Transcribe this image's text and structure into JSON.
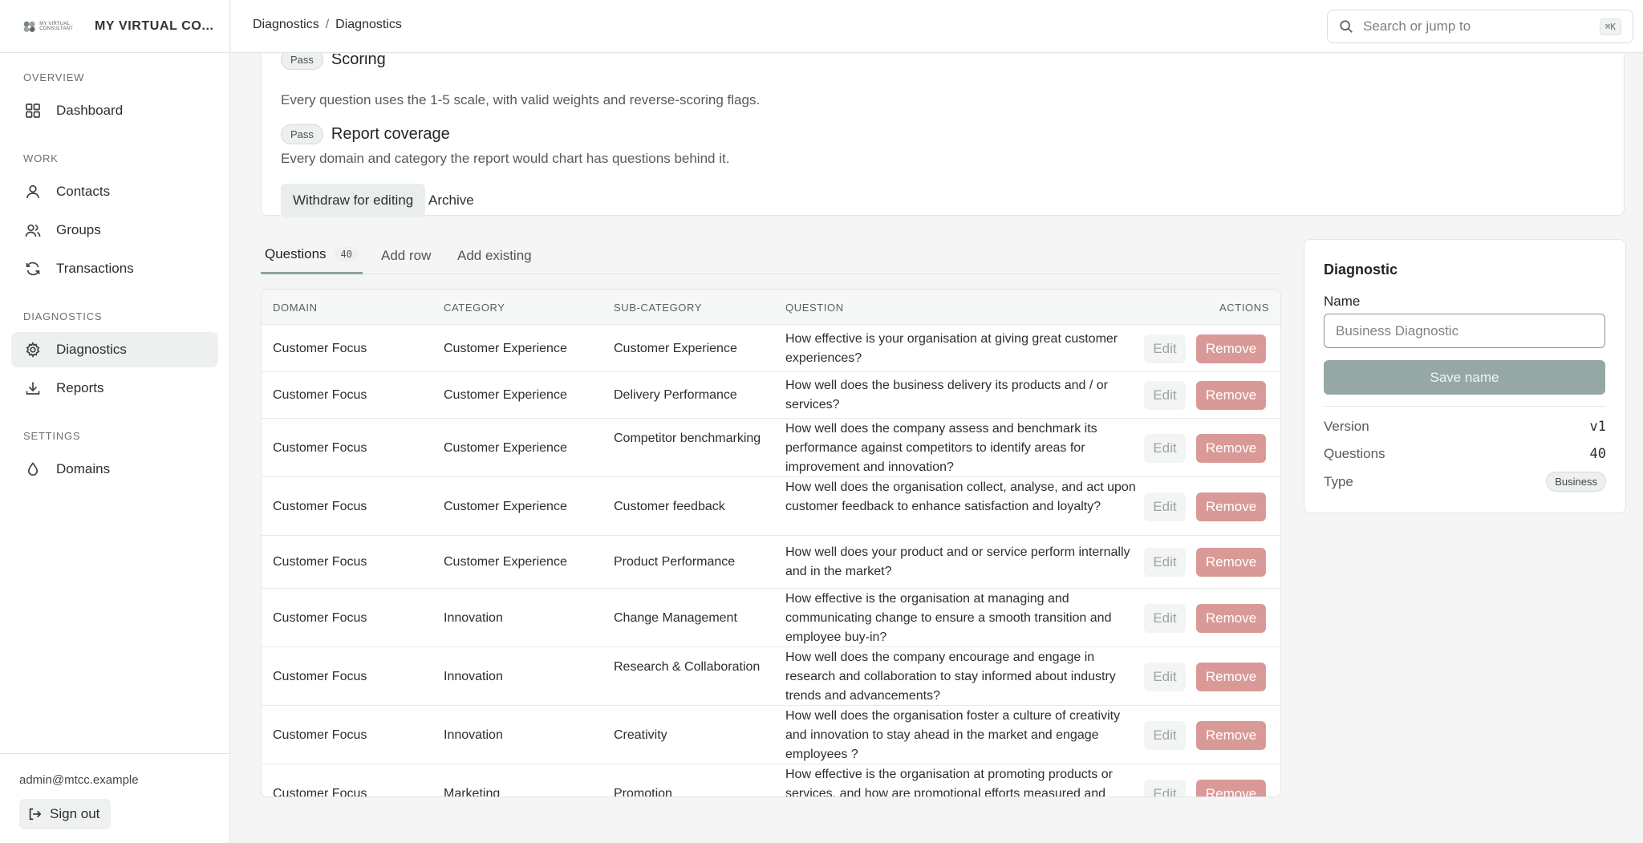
{
  "brand": {
    "logo_text": "MY VIRTUAL CONSULTANT",
    "name": "MY VIRTUAL CO..."
  },
  "sidebar": {
    "sections": [
      {
        "label": "OVERVIEW"
      },
      {
        "label": "WORK"
      },
      {
        "label": "DIAGNOSTICS"
      },
      {
        "label": "SETTINGS"
      }
    ],
    "items": [
      {
        "label": "Dashboard",
        "icon": "grid-icon"
      },
      {
        "label": "Contacts",
        "icon": "user-icon"
      },
      {
        "label": "Groups",
        "icon": "users-icon"
      },
      {
        "label": "Transactions",
        "icon": "refresh-icon"
      },
      {
        "label": "Diagnostics",
        "icon": "gear-icon",
        "active": true
      },
      {
        "label": "Reports",
        "icon": "download-icon"
      },
      {
        "label": "Domains",
        "icon": "drop-icon"
      }
    ],
    "user_email": "admin@mtcc.example",
    "signout_label": "Sign out"
  },
  "topbar": {
    "breadcrumb": [
      "Diagnostics",
      "/",
      "Diagnostics"
    ],
    "search_placeholder": "Search or jump to",
    "search_shortcut": "⌘K"
  },
  "checks": [
    {
      "badge": "Pass",
      "title": "Scoring",
      "description": "Every question uses the 1-5 scale, with valid weights and reverse-scoring flags."
    },
    {
      "badge": "Pass",
      "title": "Report coverage",
      "description": "Every domain and category the report would chart has questions behind it."
    }
  ],
  "actions": {
    "withdraw_label": "Withdraw for editing",
    "archive_label": "Archive"
  },
  "tabs": [
    {
      "label": "Questions",
      "count": "40",
      "active": true
    },
    {
      "label": "Add row"
    },
    {
      "label": "Add existing"
    }
  ],
  "table": {
    "columns": [
      "DOMAIN",
      "CATEGORY",
      "SUB-CATEGORY",
      "QUESTION",
      "ACTIONS"
    ],
    "edit_label": "Edit",
    "remove_label": "Remove",
    "rows": [
      {
        "domain": "Customer Focus",
        "category": "Customer Experience",
        "subcategory": "Customer Experience",
        "question": "How effective is your organisation at giving great customer experiences?"
      },
      {
        "domain": "Customer Focus",
        "category": "Customer Experience",
        "subcategory": "Delivery Performance",
        "question": "How well does the business delivery its products and / or services?"
      },
      {
        "domain": "Customer Focus",
        "category": "Customer Experience",
        "subcategory": "Competitor benchmarking",
        "question": "How well does the company assess and benchmark its performance against competitors to identify areas for improvement and innovation?"
      },
      {
        "domain": "Customer Focus",
        "category": "Customer Experience",
        "subcategory": "Customer feedback",
        "question": "How well does the organisation collect, analyse, and act upon customer feedback to enhance satisfaction and loyalty?"
      },
      {
        "domain": "Customer Focus",
        "category": "Customer Experience",
        "subcategory": "Product Performance",
        "question": "How well does your product and or service perform internally and in the market?"
      },
      {
        "domain": "Customer Focus",
        "category": "Innovation",
        "subcategory": "Change Management",
        "question": "How effective is the organisation at managing and communicating change to ensure a smooth transition and employee buy-in?"
      },
      {
        "domain": "Customer Focus",
        "category": "Innovation",
        "subcategory": "Research & Collaboration",
        "question": "How well does the company encourage and engage in research and collaboration to stay informed about industry trends and advancements?"
      },
      {
        "domain": "Customer Focus",
        "category": "Innovation",
        "subcategory": "Creativity",
        "question": "How well does the organisation foster a culture of creativity and innovation to stay ahead in the market and engage employees ?"
      },
      {
        "domain": "Customer Focus",
        "category": "Marketing",
        "subcategory": "Promotion",
        "question": "How effective is the organisation at promoting products or services, and how are promotional efforts measured and"
      }
    ]
  },
  "panel": {
    "title": "Diagnostic",
    "name_label": "Name",
    "name_placeholder": "Business Diagnostic",
    "save_label": "Save name",
    "version_label": "Version",
    "version_value": "v1",
    "questions_label": "Questions",
    "questions_value": "40",
    "type_label": "Type",
    "type_value": "Business"
  }
}
